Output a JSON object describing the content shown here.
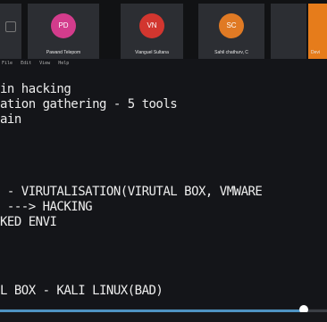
{
  "participants": [
    {
      "initials": "",
      "name": ""
    },
    {
      "initials": "PD",
      "name": "Pawand Telepom"
    },
    {
      "initials": "VN",
      "name": "Vianguel Sultana"
    },
    {
      "initials": "SC",
      "name": "Sahil chathurv, C"
    },
    {
      "initials": "",
      "name": ""
    },
    {
      "initials": "",
      "name": "Devi"
    }
  ],
  "terminal": {
    "menu": [
      "File",
      "Edit",
      "View",
      "Help"
    ],
    "lines": [
      "in hacking",
      "ation gathering - 5 tools",
      "ain",
      "",
      "",
      "",
      " - VIRUTALISATION(VIRUTAL BOX, VMWARE",
      " ---> HACKING",
      "KED ENVI",
      "",
      "",
      "",
      "L BOX - KALI LINUX(BAD)"
    ]
  },
  "playback": {
    "progress_fraction": 0.93
  },
  "colors": {
    "active_speaker": "#e67c1b",
    "progress": "#4e93c2"
  }
}
